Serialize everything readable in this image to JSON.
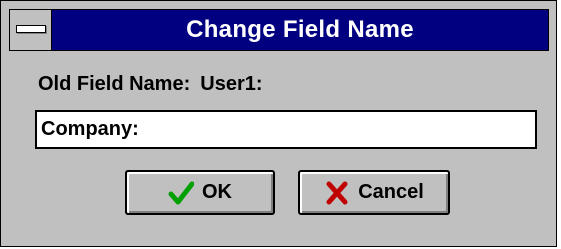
{
  "dialog": {
    "title": "Change Field Name",
    "old_field_label": "Old Field Name:",
    "old_field_value": "User1:",
    "new_field_value": "Company:",
    "ok_label": "OK",
    "cancel_label": "Cancel",
    "ok_icon": "checkmark-icon",
    "cancel_icon": "x-icon"
  },
  "colors": {
    "titlebar": "#000080",
    "dialog_bg": "#c0c0c0",
    "check": "#00a000",
    "x_mark": "#c00000"
  }
}
